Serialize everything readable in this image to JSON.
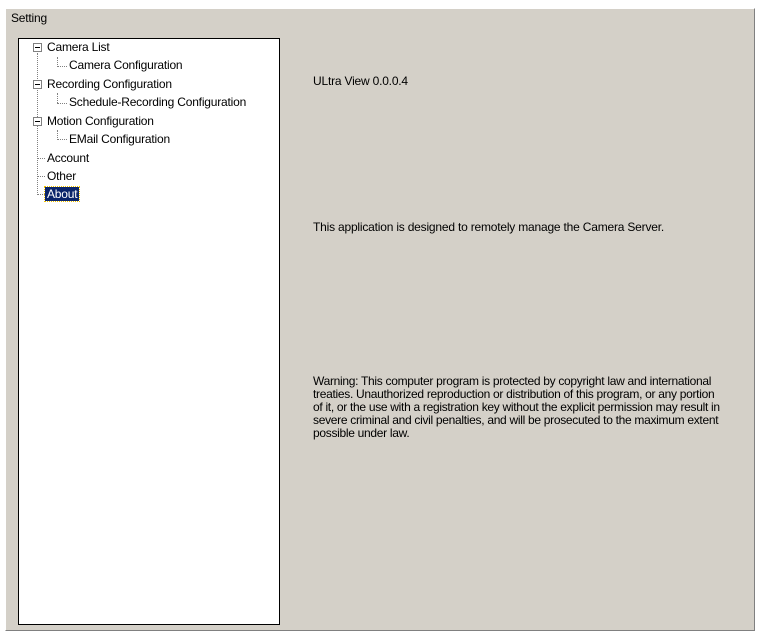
{
  "window": {
    "group_title": "Setting"
  },
  "tree": {
    "camera_list": "Camera List",
    "camera_configuration": "Camera Configuration",
    "recording_configuration": "Recording Configuration",
    "schedule_recording_configuration": "Schedule-Recording Configuration",
    "motion_configuration": "Motion Configuration",
    "email_configuration": "EMail Configuration",
    "account": "Account",
    "other": "Other",
    "about": "About",
    "selected": "About"
  },
  "about": {
    "version": "ULtra View 0.0.0.4",
    "description": "This application is designed to remotely manage the Camera Server.",
    "warning": "Warning: This computer program is protected by copyright law and international treaties. Unauthorized reproduction or distribution of this program, or any portion of it, or the use with a registration key without the explicit permission may result in severe criminal and civil penalties, and will be prosecuted to the maximum extent possible under law."
  },
  "colors": {
    "panel_background": "#d4d0c8",
    "selection_background": "#0a246a",
    "selection_text": "#ffffff"
  }
}
